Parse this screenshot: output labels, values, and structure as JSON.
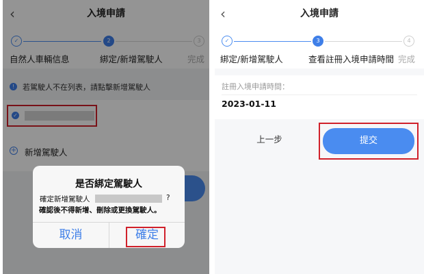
{
  "left": {
    "header": {
      "title": "入境申請",
      "back_icon": "‹"
    },
    "stepper": {
      "step1": {
        "label": "自然人車輛信息",
        "icon": "✓"
      },
      "step2": {
        "label": "綁定/新增駕駛人",
        "number": "2"
      },
      "step3": {
        "label": "完成",
        "number": "3"
      }
    },
    "notice": {
      "icon": "!",
      "text": "若駕駛人不在列表，請點擊新增駕駛人"
    },
    "driver_item": {
      "check": "✓"
    },
    "add_driver": {
      "icon": "+",
      "label": "新增駕駛人"
    },
    "dialog": {
      "title": "是否綁定駕駛人",
      "message_prefix": "確定新增駕駛人",
      "message_suffix": "?",
      "warning": "確認後不得新增、刪除或更換駕駛人。",
      "cancel_label": "取消",
      "confirm_label": "確定"
    }
  },
  "right": {
    "header": {
      "title": "入境申請",
      "back_icon": "‹"
    },
    "stepper": {
      "step1": {
        "label": "綁定/新增駕駛人",
        "icon": "✓"
      },
      "step2": {
        "label": "查看註冊入境申請時間",
        "number": "3"
      },
      "step3": {
        "label": "完成",
        "number": "4"
      }
    },
    "field": {
      "label": "註冊入境申請時間：",
      "value": "2023-01-11"
    },
    "buttons": {
      "prev_label": "上一步",
      "submit_label": "提交"
    }
  },
  "colors": {
    "accent": "#3f7fe8",
    "highlight": "#d0202a",
    "overlay": "rgba(0,0,0,0.42)"
  }
}
